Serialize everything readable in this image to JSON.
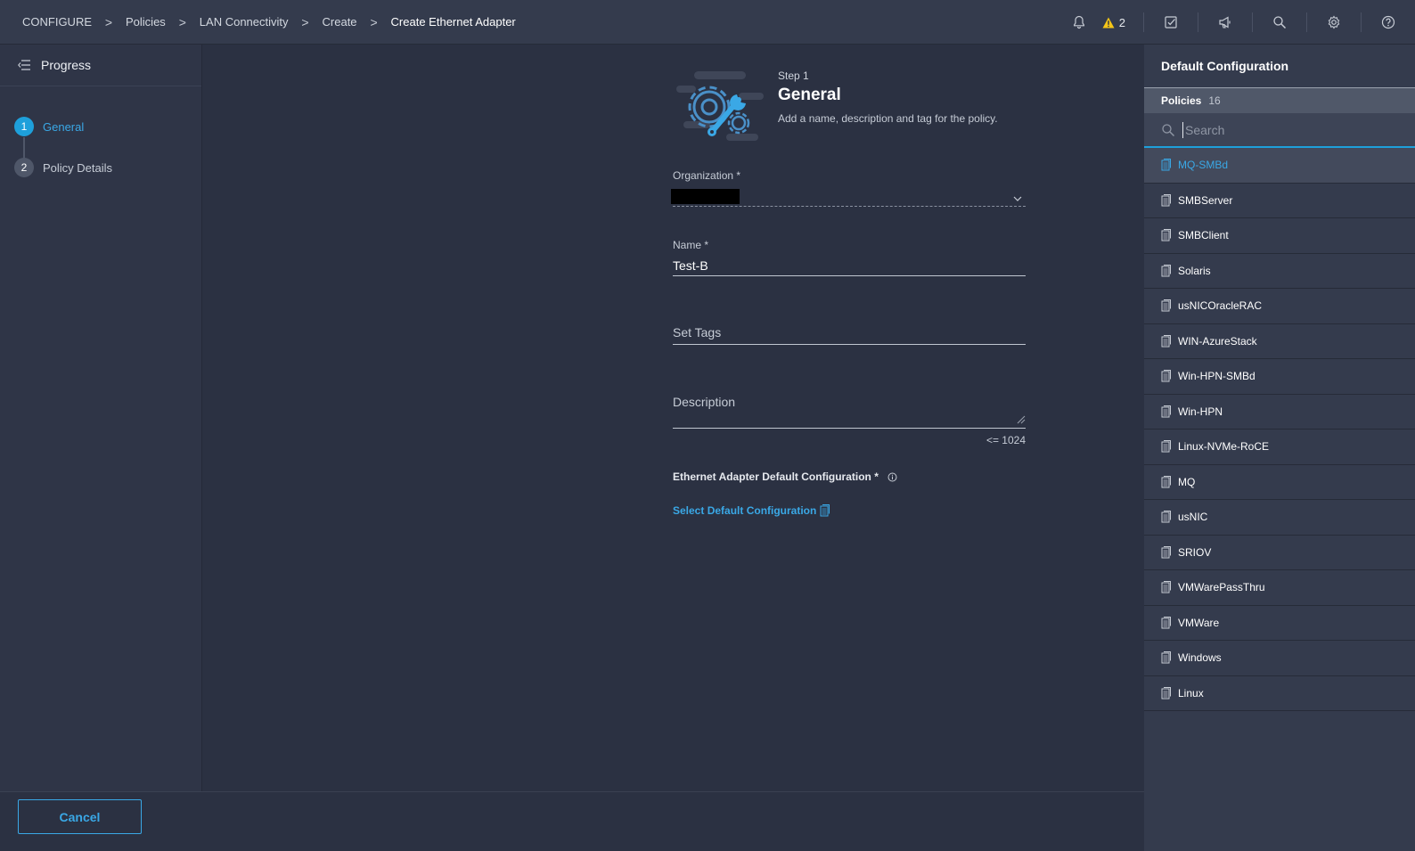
{
  "breadcrumb": {
    "items": [
      "CONFIGURE",
      "Policies",
      "LAN Connectivity",
      "Create"
    ],
    "current": "Create Ethernet Adapter",
    "separator": ">"
  },
  "topbar": {
    "alert_count": "2",
    "icons": [
      "bell-icon",
      "warning-icon",
      "checklist-icon",
      "megaphone-icon",
      "search-icon",
      "gear-icon",
      "help-icon"
    ]
  },
  "sidebar": {
    "title": "Progress",
    "steps": [
      {
        "num": "1",
        "label": "General",
        "active": true
      },
      {
        "num": "2",
        "label": "Policy Details",
        "active": false
      }
    ]
  },
  "main": {
    "step_small": "Step 1",
    "step_title": "General",
    "step_desc": "Add a name, description and tag for the policy.",
    "organization_label": "Organization *",
    "name_label": "Name *",
    "name_value": "Test-B",
    "tags_placeholder": "Set Tags",
    "description_placeholder": "Description",
    "description_counter": "<= 1024",
    "eth_config_label": "Ethernet Adapter Default Configuration *",
    "select_default_link": "Select Default Configuration"
  },
  "footer": {
    "cancel_label": "Cancel"
  },
  "right_panel": {
    "title": "Default Configuration",
    "policies_label": "Policies",
    "policies_count": "16",
    "search_placeholder": "Search",
    "policies": [
      "MQ-SMBd",
      "SMBServer",
      "SMBClient",
      "Solaris",
      "usNICOracleRAC",
      "WIN-AzureStack",
      "Win-HPN-SMBd",
      "Win-HPN",
      "Linux-NVMe-RoCE",
      "MQ",
      "usNIC",
      "SRIOV",
      "VMWarePassThru",
      "VMWare",
      "Windows",
      "Linux"
    ],
    "selected_index": 0
  },
  "colors": {
    "accent": "#1ea0db",
    "link": "#3aa8e6",
    "warning": "#f5c518",
    "background": "#2b3142"
  }
}
